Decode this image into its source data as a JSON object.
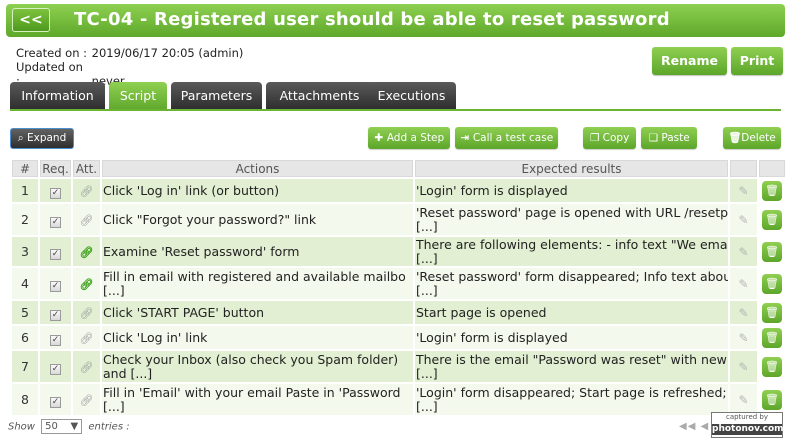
{
  "header": {
    "back_label": "<<",
    "title": "TC-04 - Registered user should be able to reset password"
  },
  "meta": {
    "created_label": "Created on :",
    "created_value": "2019/06/17 20:05 (admin)",
    "updated_label": "Updated on :",
    "updated_value": "never"
  },
  "actions": {
    "rename": "Rename",
    "print": "Print"
  },
  "tabs": [
    {
      "label": "Information",
      "active": false
    },
    {
      "label": "Script",
      "active": true
    },
    {
      "label": "Parameters",
      "active": false
    },
    {
      "label": "Attachments",
      "active": false
    },
    {
      "label": "Executions",
      "active": false
    }
  ],
  "toolbar": {
    "expand": "Expand",
    "add_step": "Add a Step",
    "call_test_case": "Call a test case",
    "copy": "Copy",
    "paste": "Paste",
    "delete": "Delete"
  },
  "table": {
    "columns": [
      "#",
      "Req.",
      "Att.",
      "Actions",
      "Expected results",
      "",
      ""
    ],
    "rows": [
      {
        "num": "1",
        "action": [
          "Click 'Log in' link (or button)"
        ],
        "expected": [
          "'Login' form is displayed"
        ],
        "att_linked": false
      },
      {
        "num": "2",
        "action": [
          "Click \"Forgot your password?\" link"
        ],
        "expected": [
          "'Reset password' page is opened with URL /resetpas",
          "[...]"
        ],
        "att_linked": false
      },
      {
        "num": "3",
        "action": [
          "Examine 'Reset password' form"
        ],
        "expected": [
          "There are following elements: - info text \"We emai",
          "[...]"
        ],
        "att_linked": true
      },
      {
        "num": "4",
        "action": [
          "Fill in email with registered and available mailbo",
          "[...]"
        ],
        "expected": [
          "'Reset password' form disappeared; Info text about",
          "[...]"
        ],
        "att_linked": true
      },
      {
        "num": "5",
        "action": [
          "Click 'START PAGE' button"
        ],
        "expected": [
          "Start page is opened"
        ],
        "att_linked": false
      },
      {
        "num": "6",
        "action": [
          "Click 'Log in' link"
        ],
        "expected": [
          "'Login' form is displayed"
        ],
        "att_linked": false
      },
      {
        "num": "7",
        "action": [
          "Check your Inbox (also check you Spam folder)",
          "and [...]"
        ],
        "expected": [
          "There is the email \"Password was reset\" with new p",
          "[...]"
        ],
        "att_linked": false
      },
      {
        "num": "8",
        "action": [
          "Fill in 'Email' with your email Paste in 'Password",
          "[...]"
        ],
        "expected": [
          "'Login' form disappeared; Start page is refreshed;",
          "[...]"
        ],
        "att_linked": false
      }
    ]
  },
  "footer": {
    "show_label": "Show",
    "page_size": "50",
    "entries_label": "entries :",
    "pager": "◀◀ ◀"
  },
  "watermark": {
    "line1": "captured by",
    "line2": "photonov.com"
  },
  "colors": {
    "brand_green": "#6bb332",
    "row_odd": "#e2efd2",
    "row_even": "#f4f9ee",
    "tab_dark": "#333333"
  }
}
